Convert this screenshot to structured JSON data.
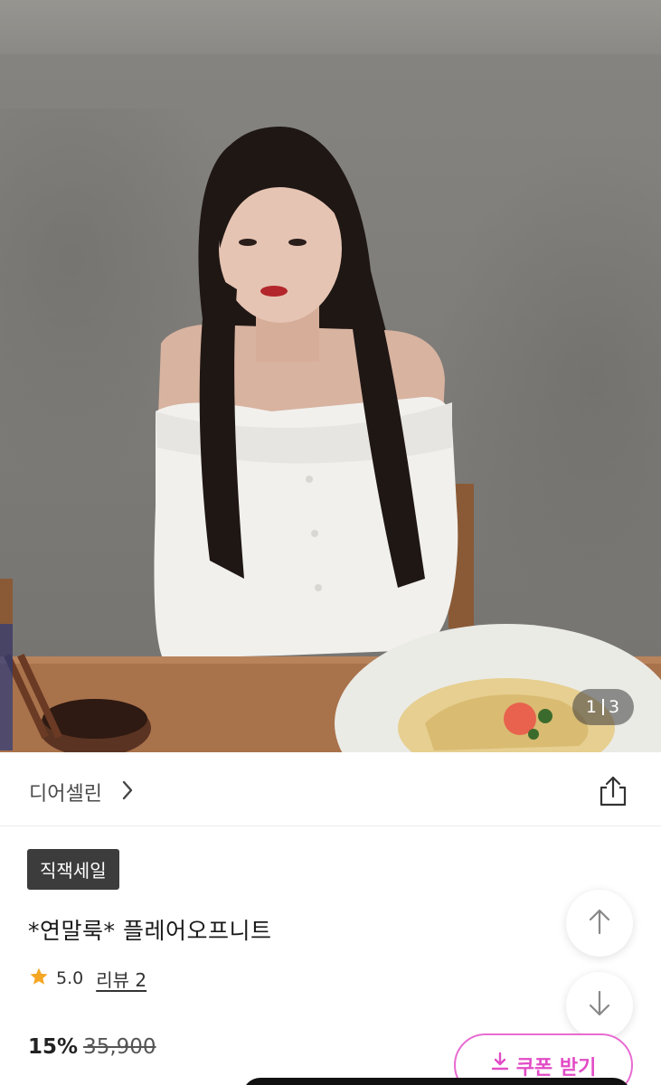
{
  "gallery": {
    "image_alt": "product photo",
    "current": "1",
    "total": "3"
  },
  "brand": {
    "name": "디어셀린"
  },
  "product": {
    "badge": "직잭세일",
    "title": "*연말룩* 플레어오프니트",
    "rating": "5.0",
    "review_label": "리뷰 2",
    "discount": "15%",
    "original_price": "35,900"
  },
  "actions": {
    "coupon_label": "쿠폰 받기"
  },
  "colors": {
    "badge_bg": "#3c3c3c",
    "coupon_accent": "#e24cc6",
    "star": "#f5a623"
  },
  "icons": {
    "brand_chevron": "chevron-right-icon",
    "share": "share-icon",
    "star": "star-icon",
    "scroll_up": "arrow-up-icon",
    "scroll_down": "arrow-down-icon",
    "coupon": "download-icon"
  }
}
